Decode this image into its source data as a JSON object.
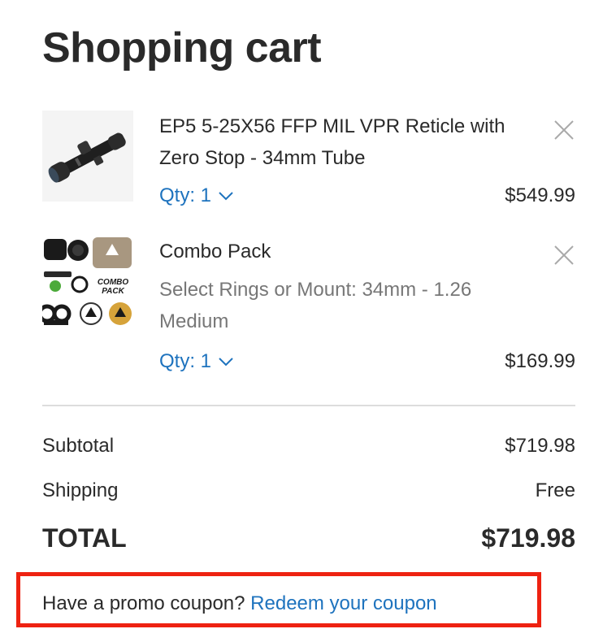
{
  "page": {
    "title": "Shopping cart"
  },
  "cart": {
    "items": [
      {
        "name": "EP5 5-25X56 FFP MIL VPR Reticle with Zero Stop - 34mm Tube",
        "option": "",
        "qty_label": "Qty: 1",
        "price": "$549.99",
        "thumbnail_icon": "rifle-scope-image"
      },
      {
        "name": "Combo Pack",
        "option": "Select Rings or Mount: 34mm - 1.26 Medium",
        "qty_label": "Qty: 1",
        "price": "$169.99",
        "thumbnail_icon": "combo-pack-image",
        "thumbnail_text": "COMBO PACK"
      }
    ]
  },
  "summary": {
    "subtotal_label": "Subtotal",
    "subtotal_value": "$719.98",
    "shipping_label": "Shipping",
    "shipping_value": "Free",
    "total_label": "TOTAL",
    "total_value": "$719.98"
  },
  "promo": {
    "prompt": "Have a promo coupon?",
    "link": "Redeem your coupon"
  },
  "colors": {
    "link": "#1e73be",
    "highlight_border": "#ee2211",
    "divider": "#dddddd"
  }
}
